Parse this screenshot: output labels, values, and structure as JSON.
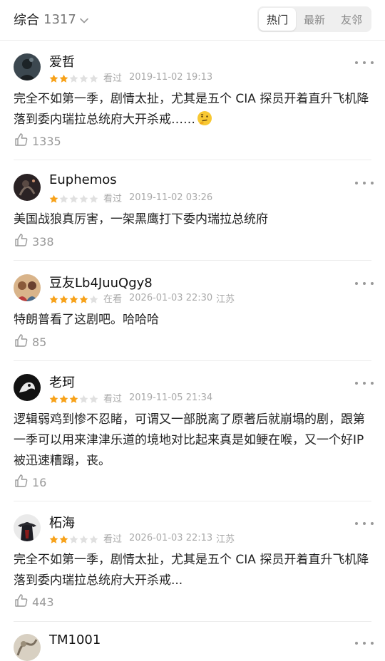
{
  "header": {
    "sort_label": "综合",
    "count": "1317",
    "tabs": [
      {
        "label": "热门",
        "active": true
      },
      {
        "label": "最新",
        "active": false
      },
      {
        "label": "友邻",
        "active": false
      }
    ]
  },
  "colors": {
    "star": "#f7a21a",
    "star_empty": "#e0e0e0",
    "meta": "#aaaaaa"
  },
  "reviews": [
    {
      "user": "爱哲",
      "rating": 2,
      "status": "看过",
      "time": "2019-11-02 19:13",
      "location": "",
      "text": "完全不如第一季，剧情太扯，尤其是五个 CIA 探员开着直升飞机降落到委内瑞拉总统府大开杀戒……",
      "emoji": "thinking-face-icon",
      "likes": "1335"
    },
    {
      "user": "Euphemos",
      "rating": 1,
      "status": "看过",
      "time": "2019-11-02 03:26",
      "location": "",
      "text": "美国战狼真厉害，一架黑鹰打下委内瑞拉总统府",
      "likes": "338"
    },
    {
      "user": "豆友Lb4JuuQgy8",
      "rating": 4,
      "status": "在看",
      "time": "2026-01-03 22:30",
      "location": "江苏",
      "text": "特朗普看了这剧吧。哈哈哈",
      "likes": "85"
    },
    {
      "user": "老珂",
      "rating": 3,
      "status": "看过",
      "time": "2019-11-05 21:34",
      "location": "",
      "text": "逻辑弱鸡到惨不忍睹，可谓又一部脱离了原著后就崩塌的剧，跟第一季可以用来津津乐道的境地对比起来真是如鲠在喉，又一个好IP被迅速糟蹋，丧。",
      "likes": "16"
    },
    {
      "user": "柘海",
      "rating": 2,
      "status": "看过",
      "time": "2026-01-03 22:13",
      "location": "江苏",
      "text": "完全不如第一季，剧情太扯，尤其是五个 CIA 探员开着直升飞机降落到委内瑞拉总统府大开杀戒...",
      "likes": "443"
    },
    {
      "user": "TM1001"
    }
  ]
}
